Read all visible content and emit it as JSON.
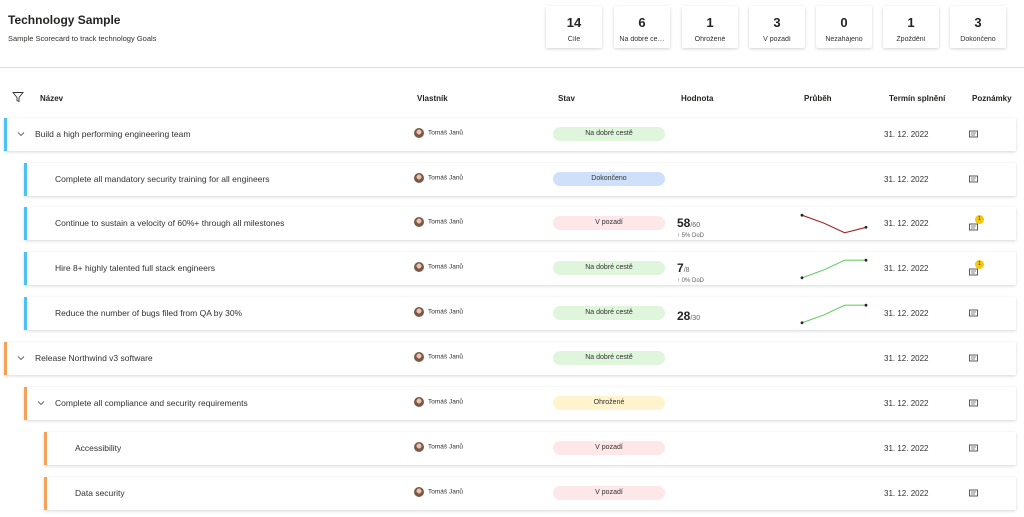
{
  "header": {
    "title": "Technology Sample",
    "subtitle": "Sample Scorecard to track technology Goals"
  },
  "stats": [
    {
      "num": "14",
      "label": "Cíle"
    },
    {
      "num": "6",
      "label": "Na dobré ce…"
    },
    {
      "num": "1",
      "label": "Ohrožené"
    },
    {
      "num": "3",
      "label": "V pozadí"
    },
    {
      "num": "0",
      "label": "Nezahájeno"
    },
    {
      "num": "1",
      "label": "Zpoždění"
    },
    {
      "num": "3",
      "label": "Dokončeno"
    }
  ],
  "columns": {
    "name": "Název",
    "owner": "Vlastník",
    "status": "Stav",
    "value": "Hodnota",
    "progress": "Průběh",
    "due": "Termín splnění",
    "notes": "Poznámky"
  },
  "colors": {
    "blue": "#4cc2f1",
    "orange": "#f4a259",
    "green_pill": "#dff6dd",
    "blue_pill": "#cfe0fb",
    "red_pill": "#fde7e9",
    "yellow_pill": "#fff4ce",
    "trend_down": "#a4262c",
    "trend_up": "#6bd16b"
  },
  "rows": [
    {
      "name": "Build a high performing engineering team",
      "owner": "Tomáš Janů",
      "status": "Na dobré cestě",
      "due": "31. 12. 2022",
      "expanded": true
    },
    {
      "name": "Complete all mandatory security training for all engineers",
      "owner": "Tomáš Janů",
      "status": "Dokončeno",
      "due": "31. 12. 2022"
    },
    {
      "name": "Continue to sustain a velocity of 60%+ through all milestones",
      "owner": "Tomáš Janů",
      "status": "V pozadí",
      "value": "58",
      "target": "/60",
      "dod": "↑ 5% DoD",
      "due": "31. 12. 2022",
      "notes_count": "1",
      "trend": [
        0.9,
        0.55,
        0.1,
        0.35
      ]
    },
    {
      "name": "Hire 8+ highly talented full stack engineers",
      "owner": "Tomáš Janů",
      "status": "Na dobré cestě",
      "value": "7",
      "target": "/8",
      "dod": "↑ 0% DoD",
      "due": "31. 12. 2022",
      "notes_count": "1",
      "trend": [
        0.1,
        0.45,
        0.9,
        0.9
      ]
    },
    {
      "name": "Reduce the number of bugs filed from QA by 30%",
      "owner": "Tomáš Janů",
      "status": "Na dobré cestě",
      "value": "28",
      "target": "/30",
      "due": "31. 12. 2022",
      "trend": [
        0.1,
        0.45,
        0.9,
        0.9
      ]
    },
    {
      "name": "Release Northwind v3 software",
      "owner": "Tomáš Janů",
      "status": "Na dobré cestě",
      "due": "31. 12. 2022",
      "expanded": true
    },
    {
      "name": "Complete all compliance and security requirements",
      "owner": "Tomáš Janů",
      "status": "Ohrožené",
      "due": "31. 12. 2022",
      "expanded": true
    },
    {
      "name": "Accessibility",
      "owner": "Tomáš Janů",
      "status": "V pozadí",
      "due": "31. 12. 2022"
    },
    {
      "name": "Data security",
      "owner": "Tomáš Janů",
      "status": "V pozadí",
      "due": "31. 12. 2022"
    }
  ]
}
